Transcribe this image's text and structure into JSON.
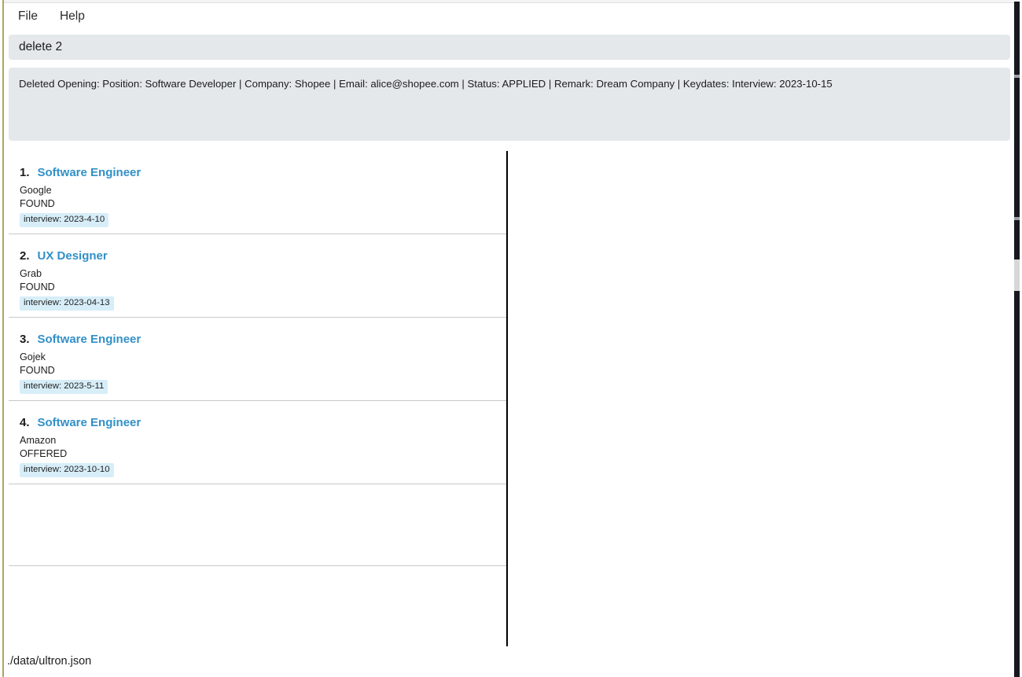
{
  "window": {
    "status_bar_path": "./data/ultron.json"
  },
  "menu": {
    "items": [
      {
        "label": "File"
      },
      {
        "label": "Help"
      }
    ]
  },
  "command": {
    "entered_text": "delete 2"
  },
  "result": {
    "message": "Deleted Opening: Position: Software Developer | Company: Shopee | Email: alice@shopee.com | Status: APPLIED | Remark: Dream Company | Keydates: Interview: 2023-10-15"
  },
  "list": {
    "items": [
      {
        "index": "1.",
        "title": "Software Engineer",
        "company": "Google",
        "status": "FOUND",
        "badges": [
          "interview: 2023-4-10"
        ]
      },
      {
        "index": "2.",
        "title": "UX Designer",
        "company": "Grab",
        "status": "FOUND",
        "badges": [
          "interview: 2023-04-13"
        ]
      },
      {
        "index": "3.",
        "title": "Software Engineer",
        "company": "Gojek",
        "status": "FOUND",
        "badges": [
          "interview: 2023-5-11"
        ]
      },
      {
        "index": "4.",
        "title": "Software Engineer",
        "company": "Amazon",
        "status": "OFFERED",
        "badges": [
          "interview: 2023-10-10"
        ]
      }
    ],
    "empty_rows": 2
  },
  "detail": {
    "content": ""
  },
  "colors": {
    "accent_blue": "#3190c8",
    "badge_bg": "#d7eef9",
    "box_bg": "#e4e8eb",
    "divider": "#000000",
    "row_separator": "#c8c8c8"
  }
}
